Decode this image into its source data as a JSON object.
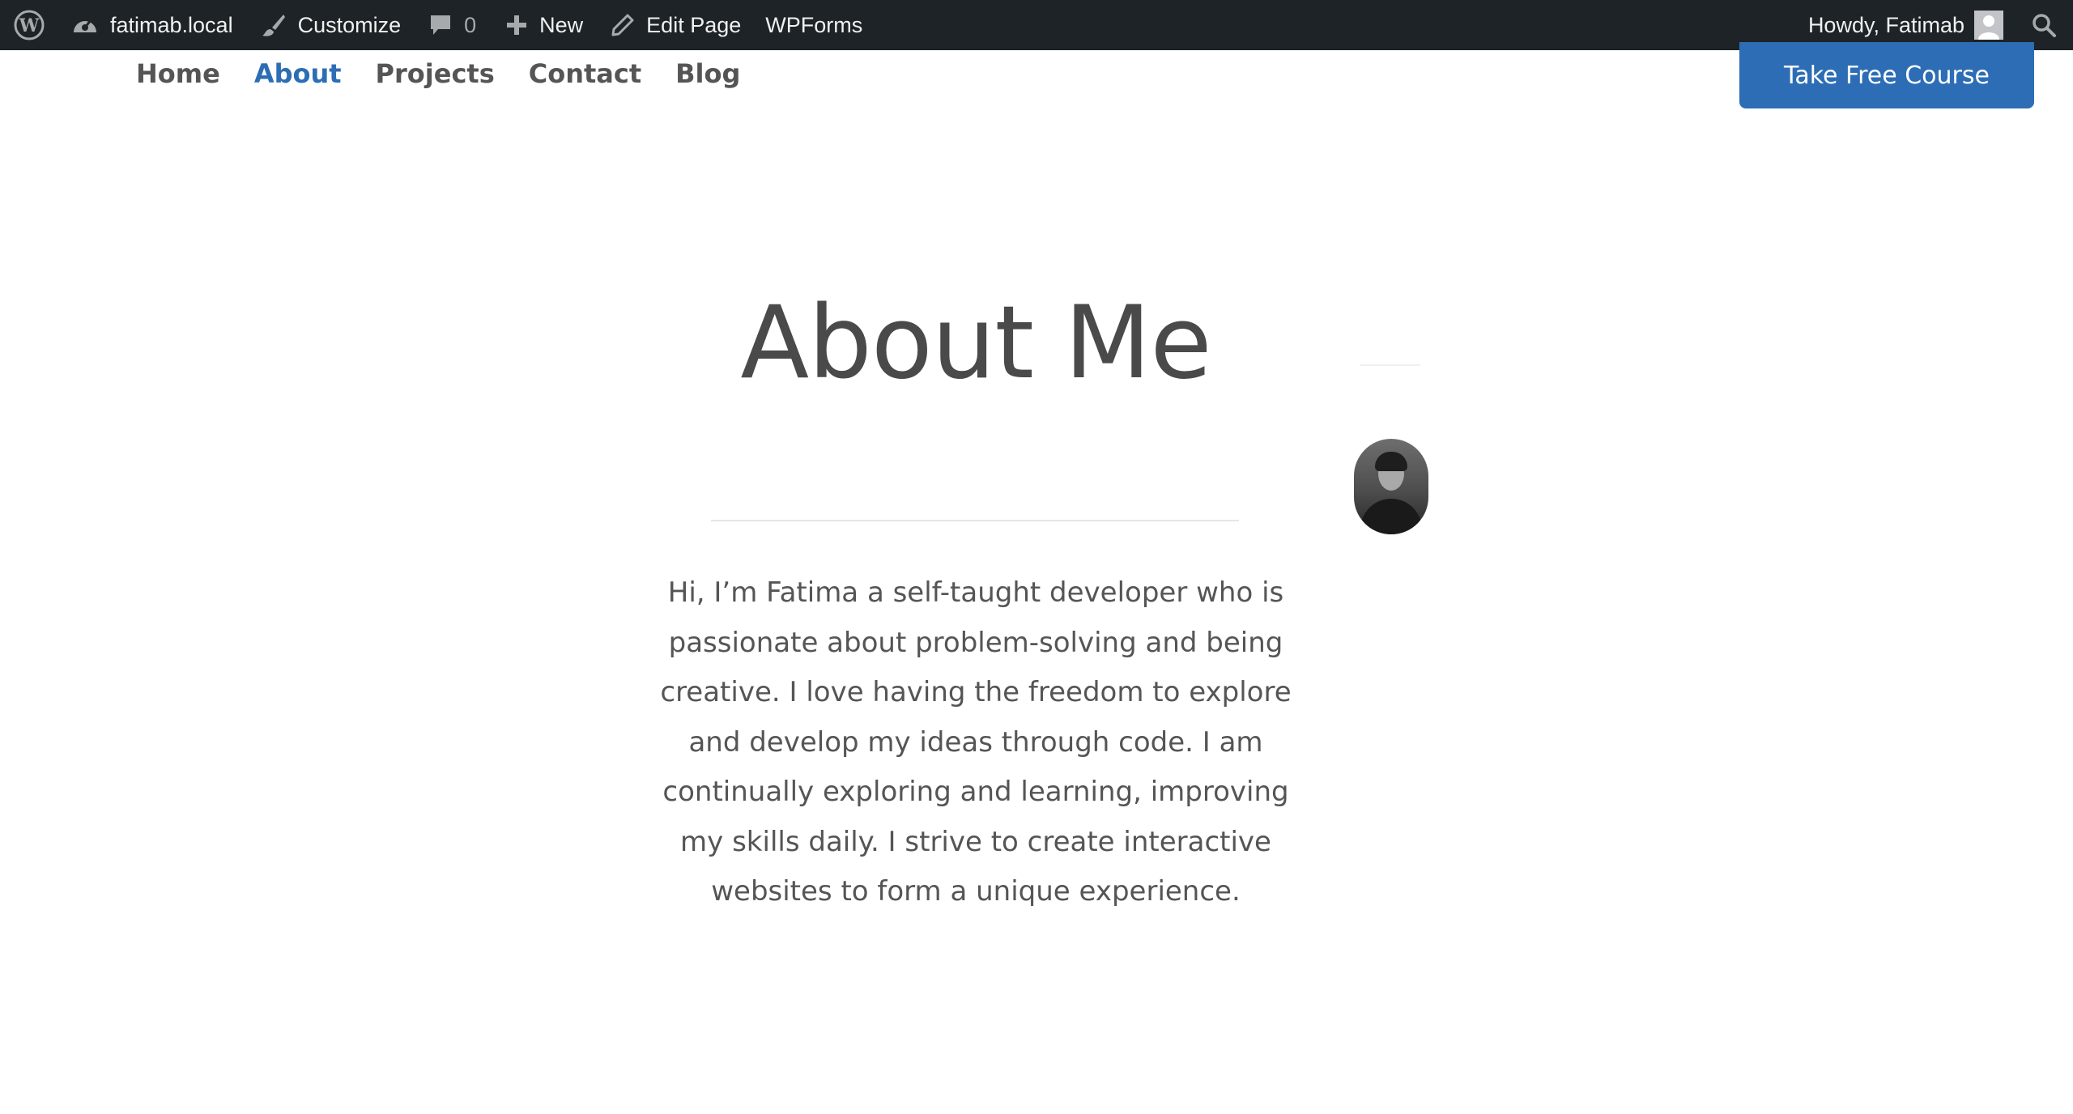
{
  "admin_bar": {
    "site_name": "fatimab.local",
    "customize_label": "Customize",
    "comments_count": "0",
    "new_label": "New",
    "edit_page_label": "Edit Page",
    "wpforms_label": "WPForms",
    "howdy_text": "Howdy, Fatimab",
    "icons": [
      "wordpress-logo-icon",
      "dashboard-icon",
      "brush-icon",
      "comment-icon",
      "plus-icon",
      "pencil-icon",
      "avatar",
      "search-icon"
    ]
  },
  "nav": {
    "items": [
      {
        "label": "Home"
      },
      {
        "label": "About"
      },
      {
        "label": "Projects"
      },
      {
        "label": "Contact"
      },
      {
        "label": "Blog"
      }
    ],
    "active_item": "About",
    "cta_label": "Take Free Course"
  },
  "main": {
    "title": "About Me",
    "bio": "Hi, I’m Fatima a self-taught developer who is passionate about problem-solving and being creative. I love having the freedom to explore and develop my ideas through code. I am continually exploring and learning, improving my skills daily. I strive to create interactive websites to form a unique experience."
  },
  "colors": {
    "admin_bar_bg": "#1d2327",
    "accent": "#2d6db5",
    "text": "#555555",
    "title": "#4a4a4a"
  }
}
